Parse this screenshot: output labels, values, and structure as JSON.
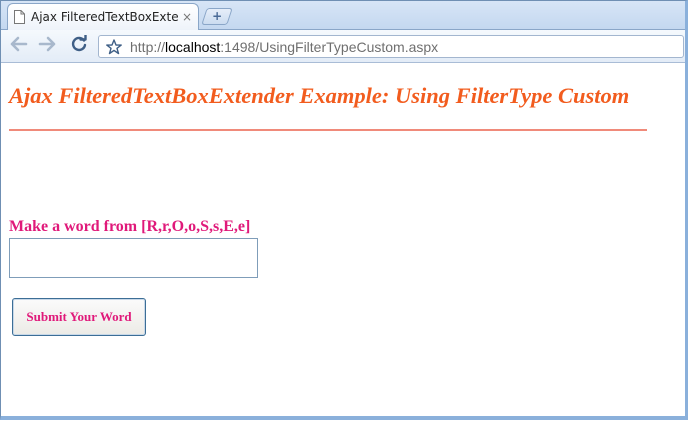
{
  "browser": {
    "tab_title": "Ajax FilteredTextBoxExten…",
    "tab_close_glyph": "×",
    "new_tab_glyph": "+",
    "url_scheme": "http://",
    "url_host": "localhost",
    "url_rest": ":1498/UsingFilterTypeCustom.aspx"
  },
  "page": {
    "title": "Ajax FilteredTextBoxExtender Example: Using FilterType Custom",
    "prompt_label": "Make a word from [R,r,O,o,S,s,E,e]",
    "word_input_value": "",
    "submit_label": "Submit Your Word"
  },
  "colors": {
    "title": "#f25c1e",
    "divider": "#f08a7a",
    "prompt": "#e0197a",
    "button_text": "#e0197a"
  },
  "icons": {
    "tab": "page-icon",
    "back": "back-arrow-icon",
    "forward": "forward-arrow-icon",
    "reload": "reload-icon",
    "bookmark": "star-icon"
  }
}
